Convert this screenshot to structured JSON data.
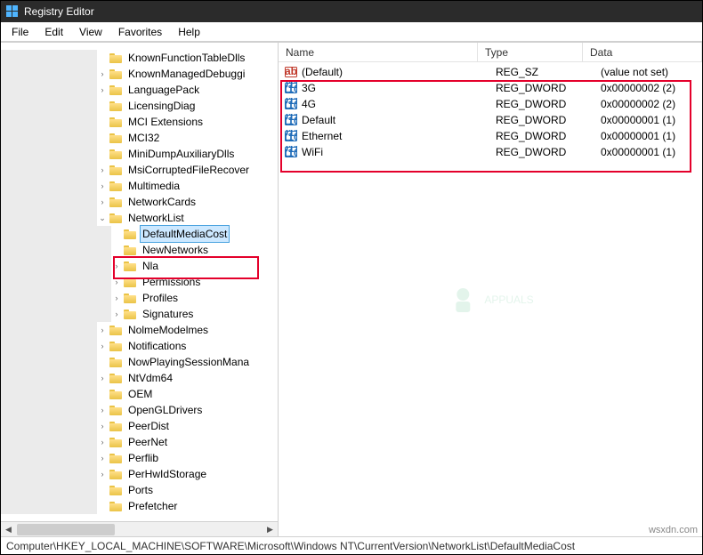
{
  "title": "Registry Editor",
  "menu": {
    "file": "File",
    "edit": "Edit",
    "view": "View",
    "favorites": "Favorites",
    "help": "Help"
  },
  "tree": {
    "items": [
      {
        "label": "KnownFunctionTableDlls",
        "depth": 7,
        "exp": ""
      },
      {
        "label": "KnownManagedDebuggi",
        "depth": 7,
        "exp": ">"
      },
      {
        "label": "LanguagePack",
        "depth": 7,
        "exp": ">"
      },
      {
        "label": "LicensingDiag",
        "depth": 7,
        "exp": ""
      },
      {
        "label": "MCI Extensions",
        "depth": 7,
        "exp": ""
      },
      {
        "label": "MCI32",
        "depth": 7,
        "exp": ""
      },
      {
        "label": "MiniDumpAuxiliaryDlls",
        "depth": 7,
        "exp": ""
      },
      {
        "label": "MsiCorruptedFileRecover",
        "depth": 7,
        "exp": ">"
      },
      {
        "label": "Multimedia",
        "depth": 7,
        "exp": ">"
      },
      {
        "label": "NetworkCards",
        "depth": 7,
        "exp": ">"
      },
      {
        "label": "NetworkList",
        "depth": 7,
        "exp": "v",
        "expanded": true
      },
      {
        "label": "DefaultMediaCost",
        "depth": 8,
        "exp": "",
        "selected": true
      },
      {
        "label": "NewNetworks",
        "depth": 8,
        "exp": ""
      },
      {
        "label": "Nla",
        "depth": 8,
        "exp": ">"
      },
      {
        "label": "Permissions",
        "depth": 8,
        "exp": ">"
      },
      {
        "label": "Profiles",
        "depth": 8,
        "exp": ">"
      },
      {
        "label": "Signatures",
        "depth": 8,
        "exp": ">"
      },
      {
        "label": "NolmeModelmes",
        "depth": 7,
        "exp": ">"
      },
      {
        "label": "Notifications",
        "depth": 7,
        "exp": ">"
      },
      {
        "label": "NowPlayingSessionMana",
        "depth": 7,
        "exp": ""
      },
      {
        "label": "NtVdm64",
        "depth": 7,
        "exp": ">"
      },
      {
        "label": "OEM",
        "depth": 7,
        "exp": ""
      },
      {
        "label": "OpenGLDrivers",
        "depth": 7,
        "exp": ">"
      },
      {
        "label": "PeerDist",
        "depth": 7,
        "exp": ">"
      },
      {
        "label": "PeerNet",
        "depth": 7,
        "exp": ">"
      },
      {
        "label": "Perflib",
        "depth": 7,
        "exp": ">"
      },
      {
        "label": "PerHwIdStorage",
        "depth": 7,
        "exp": ">"
      },
      {
        "label": "Ports",
        "depth": 7,
        "exp": ""
      },
      {
        "label": "Prefetcher",
        "depth": 7,
        "exp": ""
      }
    ]
  },
  "list": {
    "headers": {
      "name": "Name",
      "type": "Type",
      "data": "Data"
    },
    "rows": [
      {
        "icon": "str",
        "name": "(Default)",
        "type": "REG_SZ",
        "data": "(value not set)"
      },
      {
        "icon": "dword",
        "name": "3G",
        "type": "REG_DWORD",
        "data": "0x00000002 (2)"
      },
      {
        "icon": "dword",
        "name": "4G",
        "type": "REG_DWORD",
        "data": "0x00000002 (2)"
      },
      {
        "icon": "dword",
        "name": "Default",
        "type": "REG_DWORD",
        "data": "0x00000001 (1)"
      },
      {
        "icon": "dword",
        "name": "Ethernet",
        "type": "REG_DWORD",
        "data": "0x00000001 (1)"
      },
      {
        "icon": "dword",
        "name": "WiFi",
        "type": "REG_DWORD",
        "data": "0x00000001 (1)"
      }
    ]
  },
  "status": "Computer\\HKEY_LOCAL_MACHINE\\SOFTWARE\\Microsoft\\Windows NT\\CurrentVersion\\NetworkList\\DefaultMediaCost",
  "watermark": "APPUALS",
  "credit": "wsxdn.com"
}
